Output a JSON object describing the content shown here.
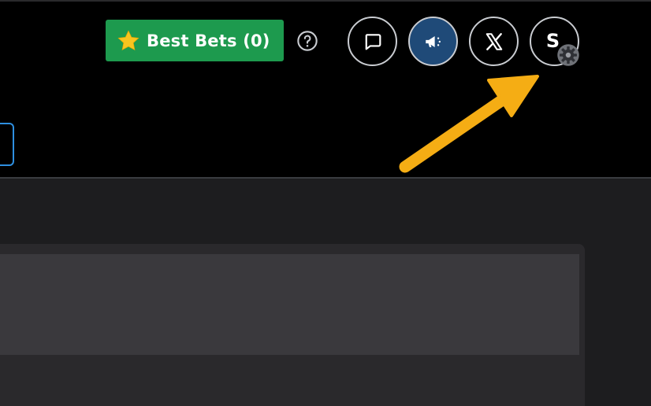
{
  "header": {
    "best_bets": {
      "icon": "star-icon",
      "label": "Best Bets (0)",
      "color": "#1d9a4e"
    },
    "help": {
      "icon": "help-circle-icon"
    },
    "actions": [
      {
        "name": "chat-button",
        "icon": "chat-bubble-icon"
      },
      {
        "name": "announcements-button",
        "icon": "megaphone-icon",
        "color": "#1f4a78"
      },
      {
        "name": "x-social-button",
        "icon": "x-logo-icon"
      }
    ],
    "profile": {
      "initial": "S",
      "badge_icon": "gear-icon"
    }
  },
  "annotation": {
    "icon": "arrow-icon",
    "color": "#f5ad14"
  }
}
